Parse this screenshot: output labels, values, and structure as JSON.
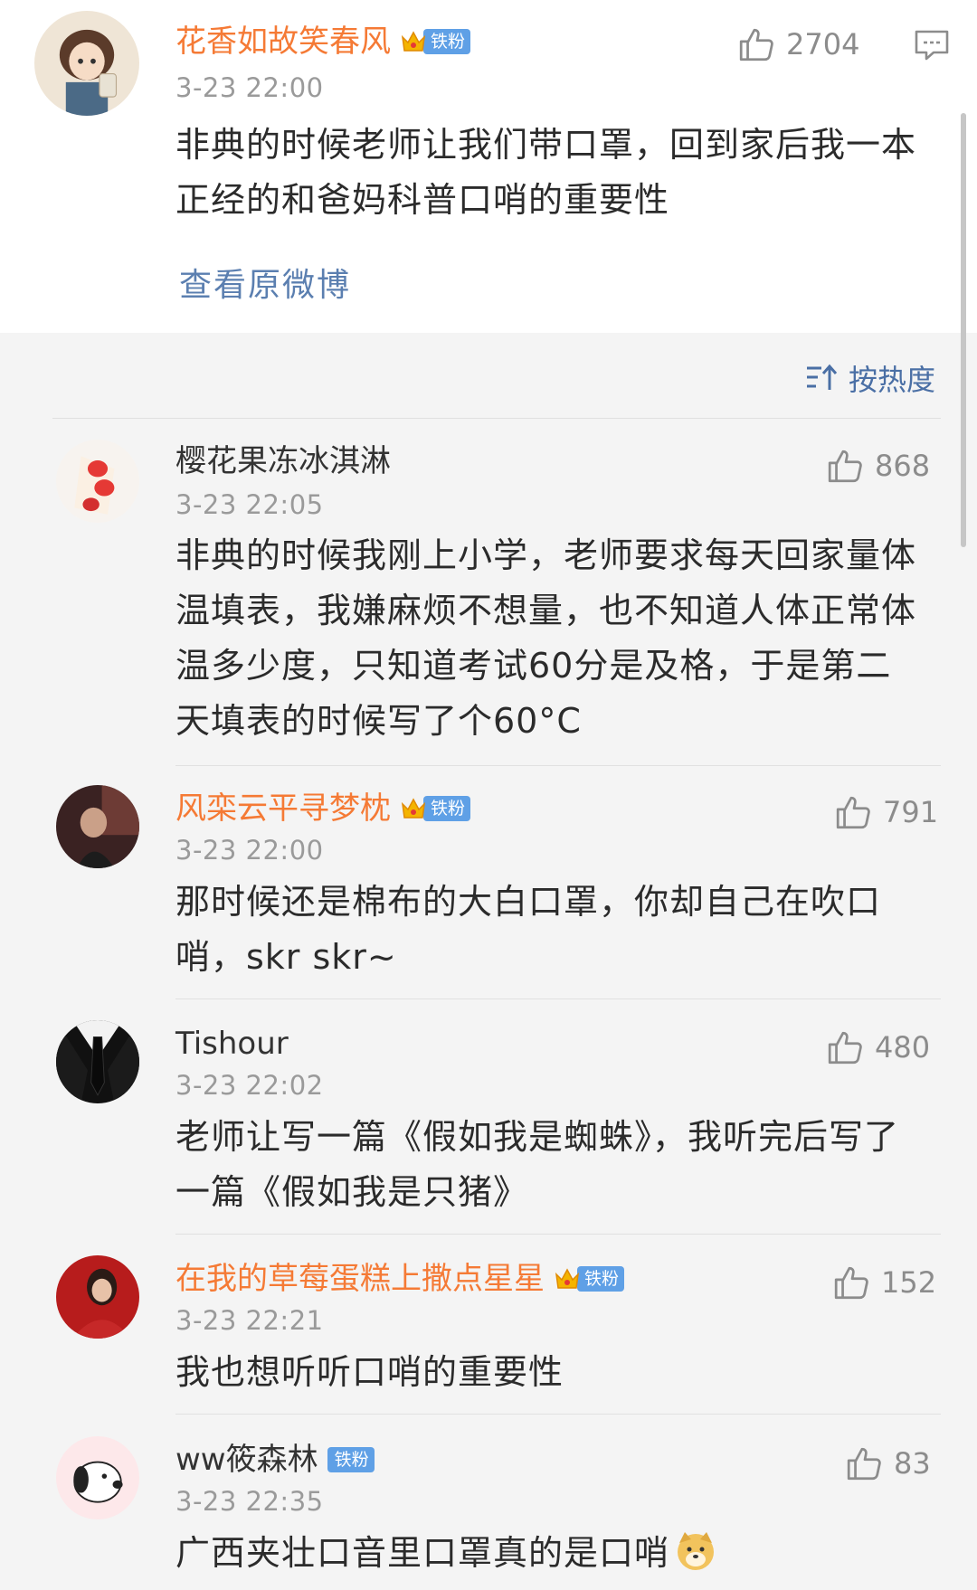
{
  "main_post": {
    "user": "花香如故笑春风",
    "badge": "铁粉",
    "time": "3-23 22:00",
    "likes": "2704",
    "text": "非典的时候老师让我们带口罩，回到家后我一本正经的和爸妈科普口哨的重要性",
    "view_original": "查看原微博"
  },
  "sort": {
    "label": "按热度"
  },
  "comments": [
    {
      "user": "樱花果冻冰淇淋",
      "badge": "",
      "time": "3-23 22:05",
      "likes": "868",
      "text": "非典的时候我刚上小学，老师要求每天回家量体温填表，我嫌麻烦不想量，也不知道人体正常体温多少度，只知道考试60分是及格，于是第二天填表的时候写了个60°C"
    },
    {
      "user": "风栾云平寻梦枕",
      "badge": "铁粉",
      "time": "3-23 22:00",
      "likes": "791",
      "text": "那时候还是棉布的大白口罩，你却自己在吹口哨，skr skr~"
    },
    {
      "user": "Tishour",
      "badge": "",
      "time": "3-23 22:02",
      "likes": "480",
      "text": "老师让写一篇《假如我是蜘蛛》，我听完后写了一篇《假如我是只猪》"
    },
    {
      "user": "在我的草莓蛋糕上撒点星星",
      "badge": "铁粉",
      "time": "3-23 22:21",
      "likes": "152",
      "text": "我也想听听口哨的重要性"
    },
    {
      "user": "ww筱森林",
      "badge": "铁粉",
      "time": "3-23 22:35",
      "likes": "83",
      "text": "广西夹壮口音里口罩真的是口哨"
    }
  ],
  "icons": {
    "like": "thumbs-up-icon",
    "comment": "comment-icon",
    "sort": "sort-icon",
    "crown": "crown-icon",
    "emoji": "doge-emoji-icon"
  },
  "colors": {
    "vip_name": "#f57a35",
    "link": "#5b7fb0",
    "badge_bg": "#5fa0e6",
    "meta": "#9a9a9a"
  }
}
